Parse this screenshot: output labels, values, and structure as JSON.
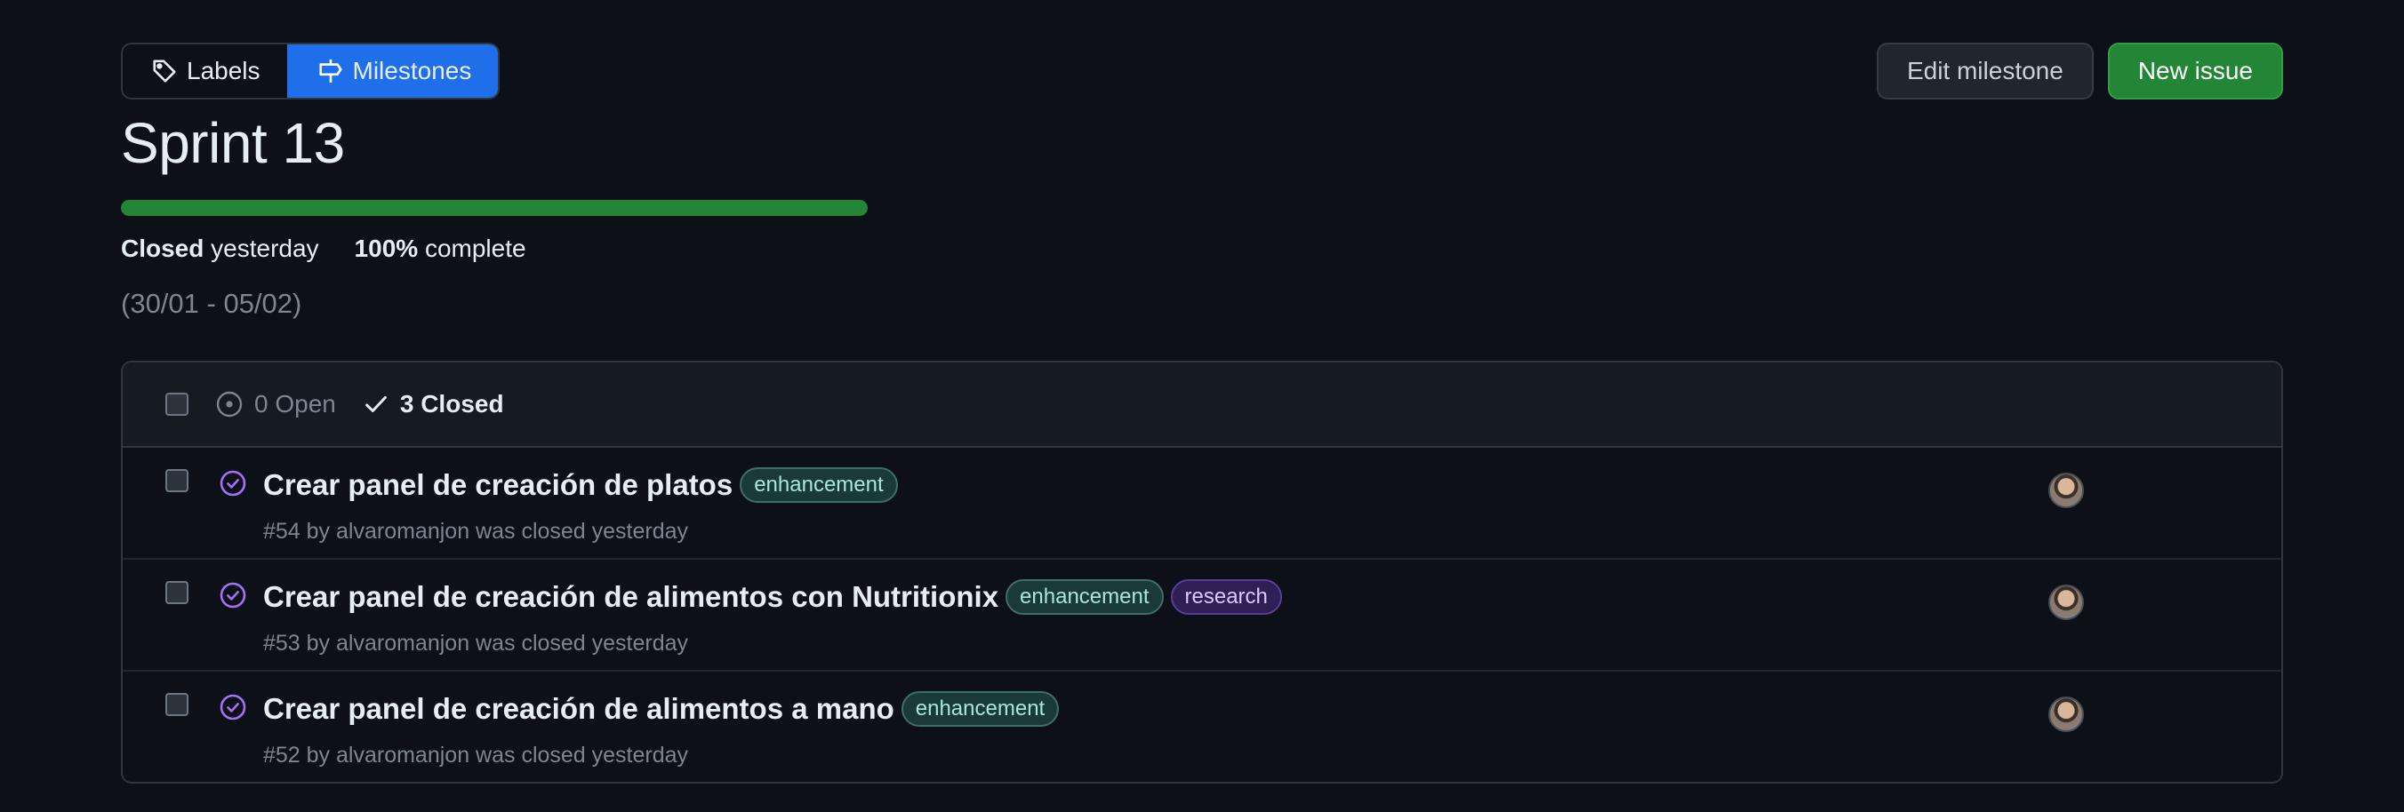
{
  "subnav": {
    "labels": "Labels",
    "milestones": "Milestones"
  },
  "actions": {
    "edit": "Edit milestone",
    "new_issue": "New issue"
  },
  "milestone": {
    "title": "Sprint 13",
    "progress_percent": 100,
    "status_strong": "Closed",
    "status_rest": "yesterday",
    "complete_strong": "100%",
    "complete_rest": "complete",
    "dates": "(30/01 - 05/02)"
  },
  "issues_header": {
    "open": "0 Open",
    "closed": "3 Closed"
  },
  "issues": [
    {
      "title": "Crear panel de creación de platos",
      "labels": [
        "enhancement"
      ],
      "meta": "#54 by alvaromanjon was closed yesterday"
    },
    {
      "title": "Crear panel de creación de alimentos con Nutritionix",
      "labels": [
        "enhancement",
        "research"
      ],
      "meta": "#53 by alvaromanjon was closed yesterday"
    },
    {
      "title": "Crear panel de creación de alimentos a mano",
      "labels": [
        "enhancement"
      ],
      "meta": "#52 by alvaromanjon was closed yesterday"
    }
  ],
  "colors": {
    "accent": "#1f6feb",
    "success": "#238636",
    "closed_icon": "#a371f7"
  },
  "icons": {
    "labels": "tag-icon",
    "milestones": "milestone-icon",
    "open": "issue-open-icon",
    "closed": "check-icon",
    "issue_closed": "issue-closed-icon"
  }
}
